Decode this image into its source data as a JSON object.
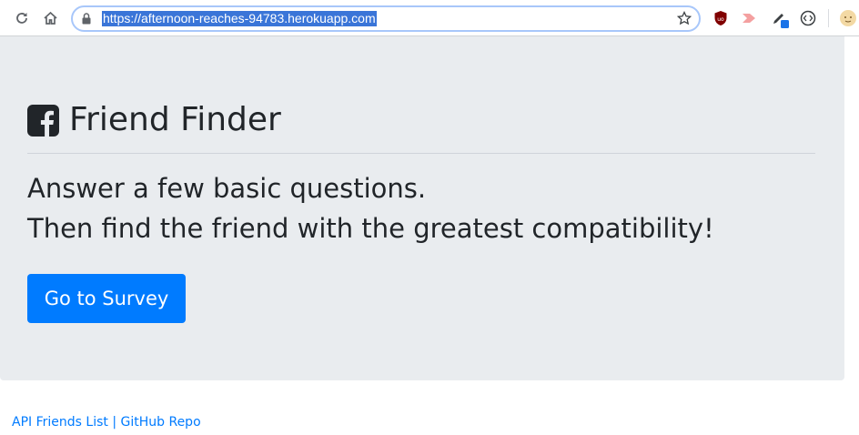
{
  "browser": {
    "url": "https://afternoon-reaches-94783.herokuapp.com",
    "icons": [
      "reload-icon",
      "home-icon",
      "lock-icon",
      "bookmark-star-icon",
      "ublock-icon",
      "play-extension-icon",
      "eyedropper-extension-icon",
      "code-extension-icon",
      "profile-avatar-icon"
    ]
  },
  "jumbotron": {
    "title": "Friend Finder",
    "lead_line1": "Answer a few basic questions.",
    "lead_line2": "Then find the friend with the greatest compatibility!",
    "button_label": "Go to Survey"
  },
  "footer": {
    "api_link": "API Friends List",
    "separator": "|",
    "github_link": "GitHub Repo"
  },
  "colors": {
    "jumbotron_bg": "#e9ecef",
    "primary": "#007bff",
    "url_highlight": "#3a75d8"
  }
}
